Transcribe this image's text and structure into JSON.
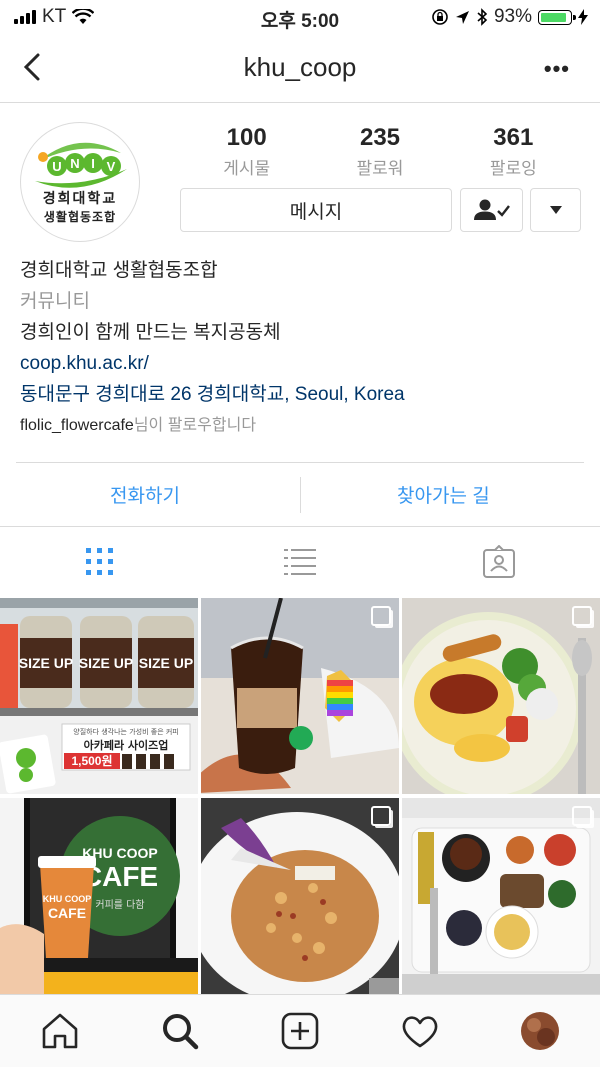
{
  "status": {
    "carrier": "KT",
    "time": "오후 5:00",
    "battery": "93%",
    "battery_level": 0.93,
    "battery_color": "#4cd964"
  },
  "nav": {
    "title": "khu_coop"
  },
  "profile": {
    "logo_text": {
      "brand": "UNIV",
      "line1": "경희대학교",
      "line2": "생활협동조합"
    },
    "stats": [
      {
        "value": "100",
        "label": "게시물"
      },
      {
        "value": "235",
        "label": "팔로워"
      },
      {
        "value": "361",
        "label": "팔로잉"
      }
    ],
    "message_label": "메시지",
    "name": "경희대학교 생활협동조합",
    "category": "커뮤니티",
    "bio": "경희인이 함께 만드는 복지공동체",
    "website": "coop.khu.ac.kr/",
    "address": "동대문구 경희대로 26 경희대학교, Seoul, Korea",
    "followed_by_user": "flolic_flowercafe",
    "followed_by_suffix": "님이 팔로우합니다"
  },
  "actions": {
    "call": "전화하기",
    "directions": "찾아가는 길"
  },
  "colors": {
    "link": "#3897f0",
    "accent_dark": "#003569"
  },
  "posts": [
    {
      "id": "post-1",
      "badges": [
        "SIZE UP",
        "SIZE UP",
        "SIZE UP"
      ],
      "sign": "아카페라 사이즈업",
      "sign_small": "양질하다 생각나는 가성비 좋은 커피",
      "price": "1,500원",
      "multiple": false
    },
    {
      "id": "post-2",
      "multiple": true
    },
    {
      "id": "post-3",
      "multiple": true
    },
    {
      "id": "post-4",
      "sign_line1": "KHU COOP",
      "sign_line2": "CAFE",
      "sign_sub": "커피를 다함",
      "cup_line1": "KHU COOP",
      "cup_line2": "CAFE",
      "multiple": false
    },
    {
      "id": "post-5",
      "multiple": true
    },
    {
      "id": "post-6",
      "multiple": true
    }
  ]
}
